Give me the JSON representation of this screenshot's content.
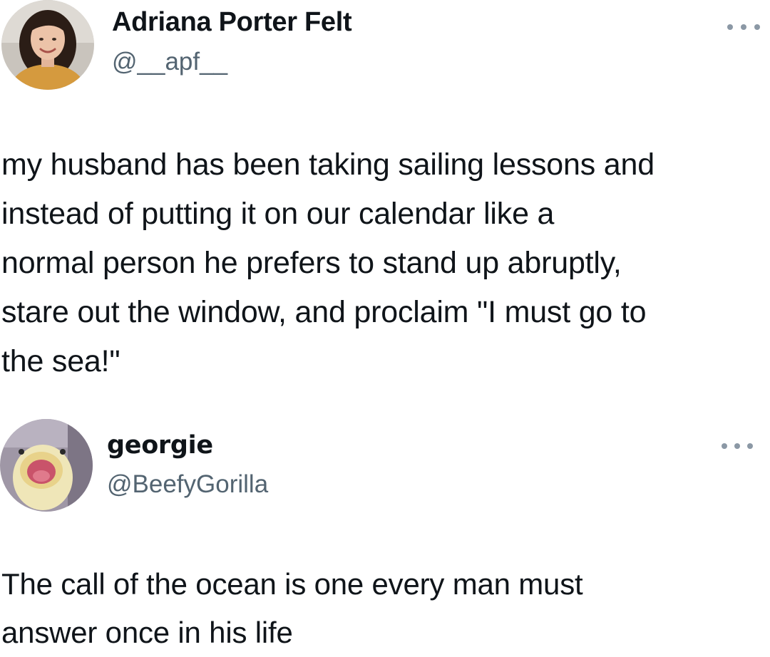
{
  "tweets": [
    {
      "author": {
        "display_name": "Adriana Porter Felt",
        "handle": "@__apf__",
        "avatar_icon": "person-photo-avatar"
      },
      "more_icon": "more-horizontal-icon",
      "text": "my husband has been taking sailing lessons and\ninstead of putting it on our calendar like a\nnormal person he prefers to stand up abruptly,\nstare out the window, and proclaim \"I must go to\nthe sea!\""
    },
    {
      "author": {
        "display_name": "georgie",
        "handle": "@BeefyGorilla",
        "avatar_icon": "duck-photo-avatar"
      },
      "more_icon": "more-horizontal-icon",
      "text": "The call of the ocean is one every man must\nanswer once in his life"
    }
  ],
  "colors": {
    "text_primary": "#0f1419",
    "text_secondary": "#536471",
    "icon_muted": "#8b98a5",
    "background": "#ffffff"
  }
}
